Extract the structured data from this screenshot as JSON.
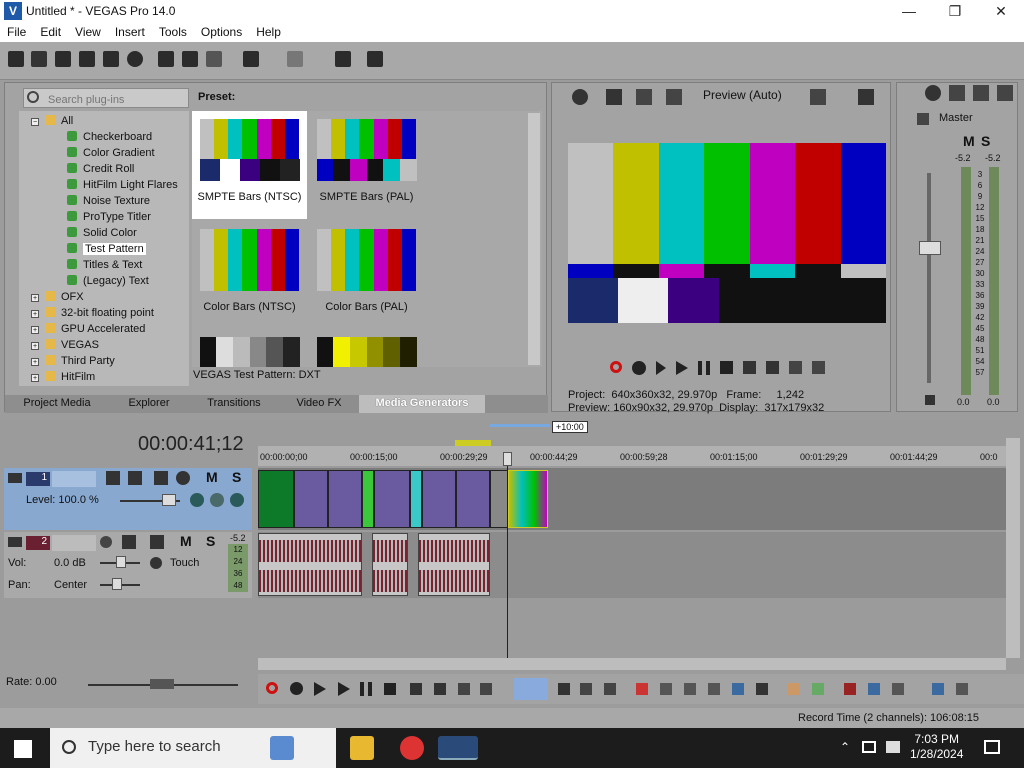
{
  "window": {
    "title": "Untitled * - VEGAS Pro 14.0",
    "logo_letter": "V",
    "controls": {
      "minimize": "—",
      "maximize": "❐",
      "close": "✕"
    }
  },
  "menu": [
    "File",
    "Edit",
    "View",
    "Insert",
    "Tools",
    "Options",
    "Help"
  ],
  "explorer": {
    "search_placeholder": "Search plug-ins",
    "tree": [
      {
        "label": "All",
        "type": "folder",
        "expander": "−"
      },
      {
        "label": "Checkerboard",
        "type": "plugin"
      },
      {
        "label": "Color Gradient",
        "type": "plugin"
      },
      {
        "label": "Credit Roll",
        "type": "plugin"
      },
      {
        "label": "HitFilm Light Flares",
        "type": "plugin"
      },
      {
        "label": "Noise Texture",
        "type": "plugin"
      },
      {
        "label": "ProType Titler",
        "type": "plugin"
      },
      {
        "label": "Solid Color",
        "type": "plugin"
      },
      {
        "label": "Test Pattern",
        "type": "plugin",
        "selected": true
      },
      {
        "label": "Titles & Text",
        "type": "plugin"
      },
      {
        "label": "(Legacy) Text",
        "type": "plugin"
      },
      {
        "label": "OFX",
        "type": "folder",
        "expander": "+"
      },
      {
        "label": "32-bit floating point",
        "type": "folder",
        "expander": "+"
      },
      {
        "label": "GPU Accelerated",
        "type": "folder",
        "expander": "+"
      },
      {
        "label": "VEGAS",
        "type": "folder",
        "expander": "+"
      },
      {
        "label": "Third Party",
        "type": "folder",
        "expander": "+"
      },
      {
        "label": "HitFilm",
        "type": "folder",
        "expander": "+"
      }
    ],
    "preset_label": "Preset:",
    "presets": [
      {
        "name": "SMPTE Bars (NTSC)",
        "selected": true
      },
      {
        "name": "SMPTE Bars (PAL)"
      },
      {
        "name": "Color Bars (NTSC)"
      },
      {
        "name": "Color Bars (PAL)"
      }
    ],
    "status": "VEGAS Test Pattern: DXT",
    "tabs": [
      "Project Media",
      "Explorer",
      "Transitions",
      "Video FX",
      "Media Generators"
    ],
    "active_tab": "Media Generators"
  },
  "preview": {
    "mode": "Preview (Auto)",
    "project_label": "Project:",
    "project_value": "640x360x32, 29.970p",
    "frame_label": "Frame:",
    "frame_value": "1,242",
    "preview_label": "Preview:",
    "preview_value": "160x90x32, 29.970p",
    "display_label": "Display:",
    "display_value": "317x179x32"
  },
  "mixer": {
    "title": "Master",
    "m": "M",
    "s": "S",
    "peak_left": "-5.2",
    "peak_right": "-5.2",
    "scale": [
      "3",
      "6",
      "9",
      "12",
      "15",
      "18",
      "21",
      "24",
      "27",
      "30",
      "33",
      "36",
      "39",
      "42",
      "45",
      "48",
      "51",
      "54",
      "57"
    ],
    "bottom_left": "0.0",
    "bottom_right": "0.0"
  },
  "timeline": {
    "timecode": "00:00:41;12",
    "zoom_badge": "+10:00",
    "ruler": [
      "00:00:00;00",
      "00:00:15;00",
      "00:00:29;29",
      "00:00:44;29",
      "00:00:59;28",
      "00:01:15;00",
      "00:01:29;29",
      "00:01:44;29",
      "00:0"
    ],
    "video_track": {
      "number": "1",
      "level_label": "Level: 100.0 %",
      "m": "M",
      "s": "S"
    },
    "audio_track": {
      "number": "2",
      "vol_label": "Vol:",
      "vol_value": "0.0 dB",
      "pan_label": "Pan:",
      "pan_value": "Center",
      "touch": "Touch",
      "m": "M",
      "s": "S",
      "peak": "-5.2",
      "meter": [
        "12",
        "24",
        "36",
        "48"
      ]
    },
    "rate": "Rate: 0.00",
    "record_time": "Record Time (2 channels): 106:08:15"
  },
  "taskbar": {
    "search_placeholder": "Type here to search",
    "time": "7:03 PM",
    "date": "1/28/2024"
  }
}
